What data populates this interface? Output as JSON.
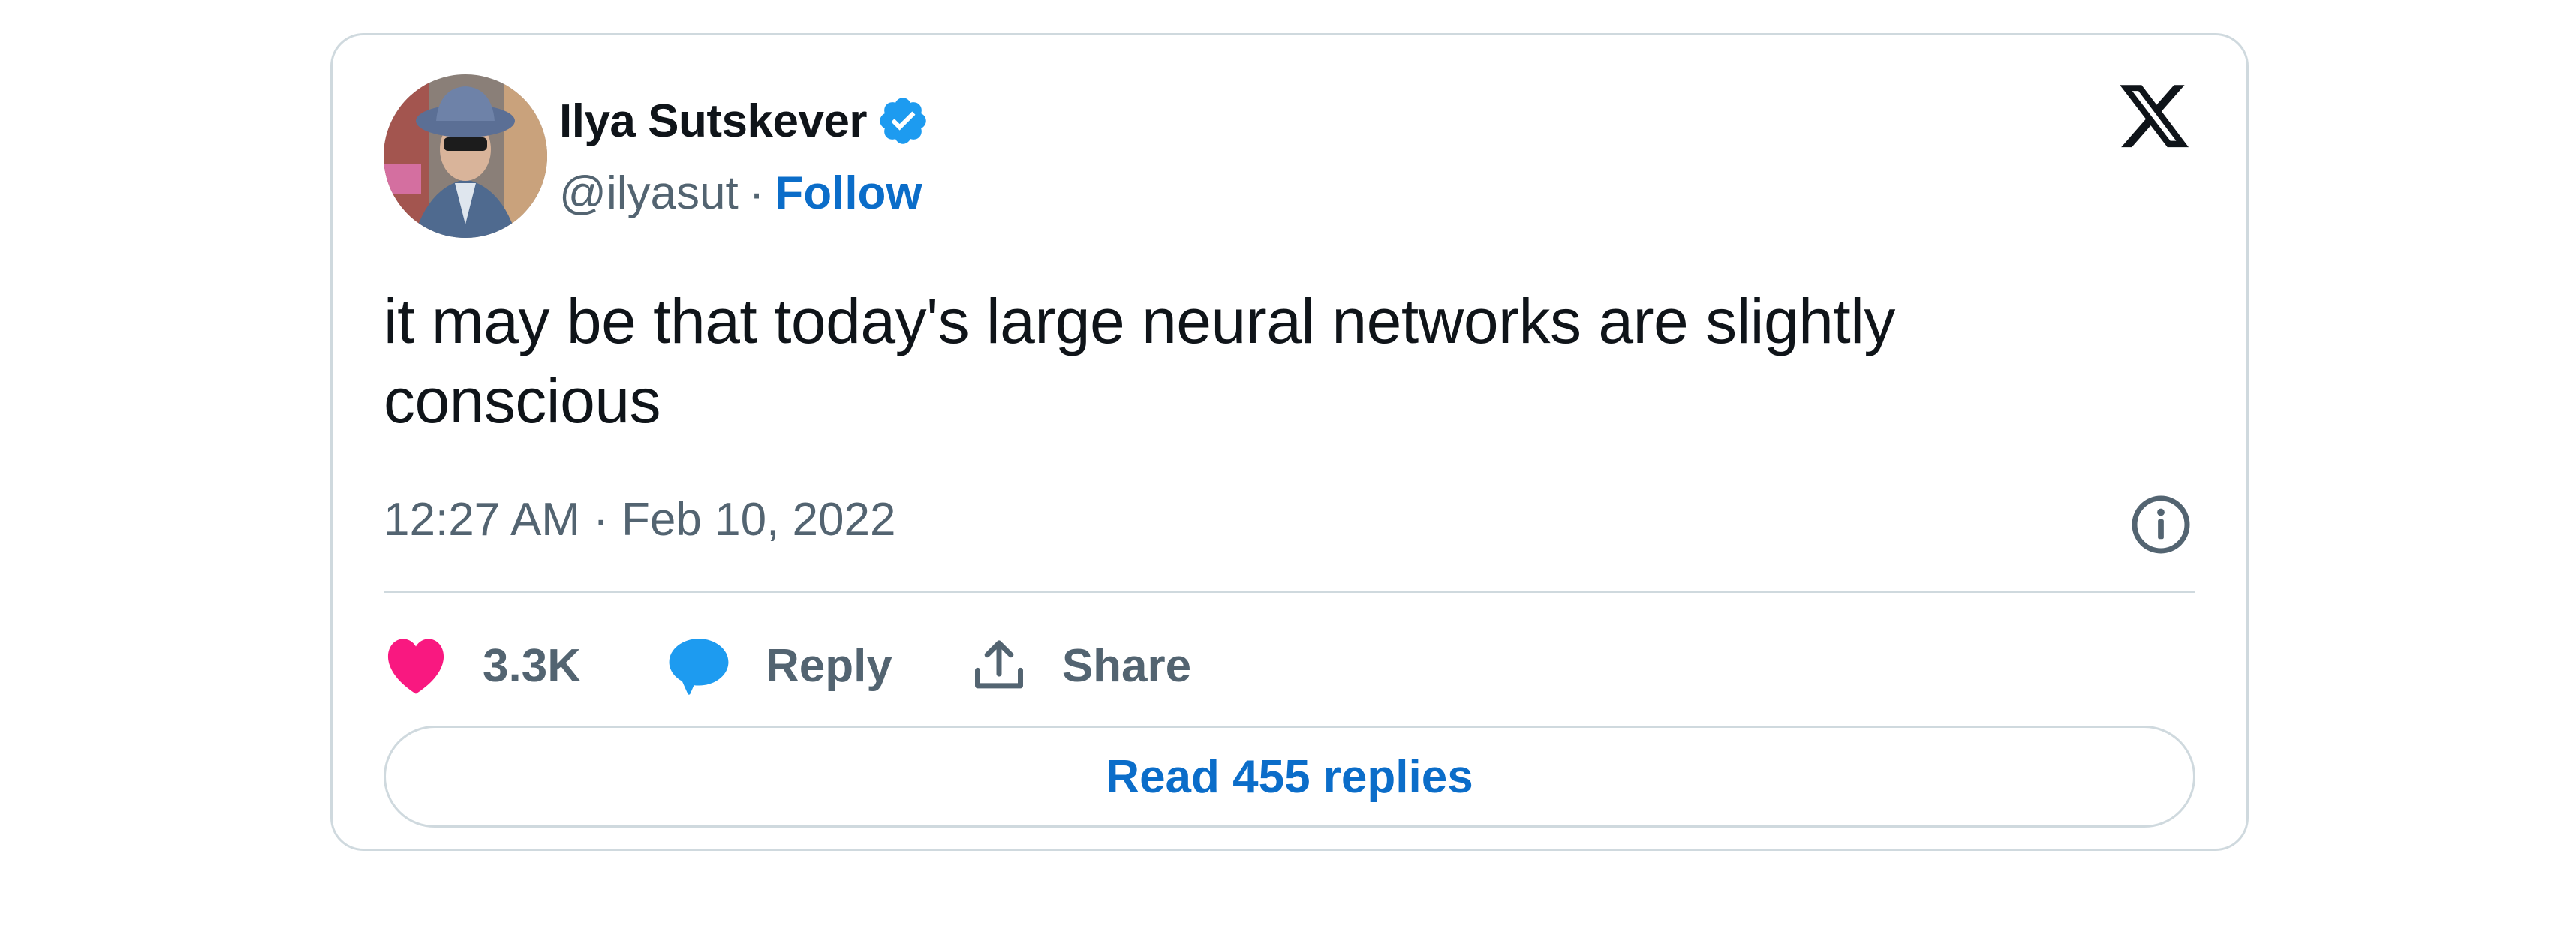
{
  "author": {
    "name": "Ilya Sutskever",
    "handle": "@ilyasut",
    "separator": "·",
    "follow_label": "Follow",
    "verified": true
  },
  "tweet": {
    "text": "it may be that today's large neural networks are slightly conscious",
    "timestamp": "12:27 AM · Feb 10, 2022"
  },
  "actions": {
    "like_count": "3.3K",
    "reply_label": "Reply",
    "share_label": "Share"
  },
  "read_replies_label": "Read 455 replies",
  "icons": {
    "verified": "verified-badge-icon",
    "logo": "x-logo-icon",
    "info": "info-icon",
    "like": "heart-icon",
    "reply": "speech-bubble-icon",
    "share": "upload-share-icon"
  },
  "colors": {
    "accent_blue": "#0b6dc9",
    "verified_blue": "#1d9bf0",
    "like_pink": "#f91880",
    "secondary_text": "#536471",
    "border": "#cfd9de"
  }
}
